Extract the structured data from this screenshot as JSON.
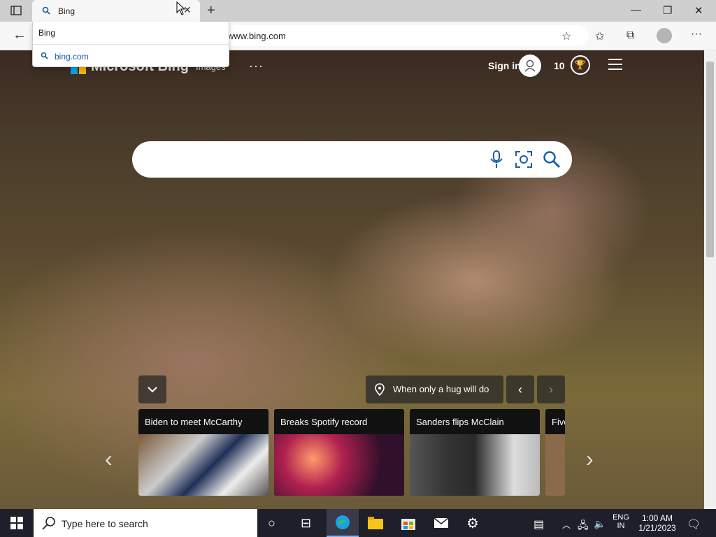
{
  "browser": {
    "tab_title": "Bing",
    "address": "www.bing.com",
    "dropdown": {
      "input_text": "Bing",
      "suggestion": "bing.com"
    }
  },
  "bing": {
    "logo": "Microsoft Bing",
    "images_link": "Images",
    "more": "···",
    "sign_in": "Sign in",
    "rewards_count": "10",
    "hug_label": "When only a hug will do",
    "cards": [
      {
        "title": "Biden to meet McCarthy"
      },
      {
        "title": "Breaks Spotify record"
      },
      {
        "title": "Sanders flips McClain"
      },
      {
        "title": "Five"
      }
    ]
  },
  "taskbar": {
    "search_placeholder": "Type here to search",
    "lang_top": "ENG",
    "lang_bottom": "IN",
    "time": "1:00 AM",
    "date": "1/21/2023"
  }
}
